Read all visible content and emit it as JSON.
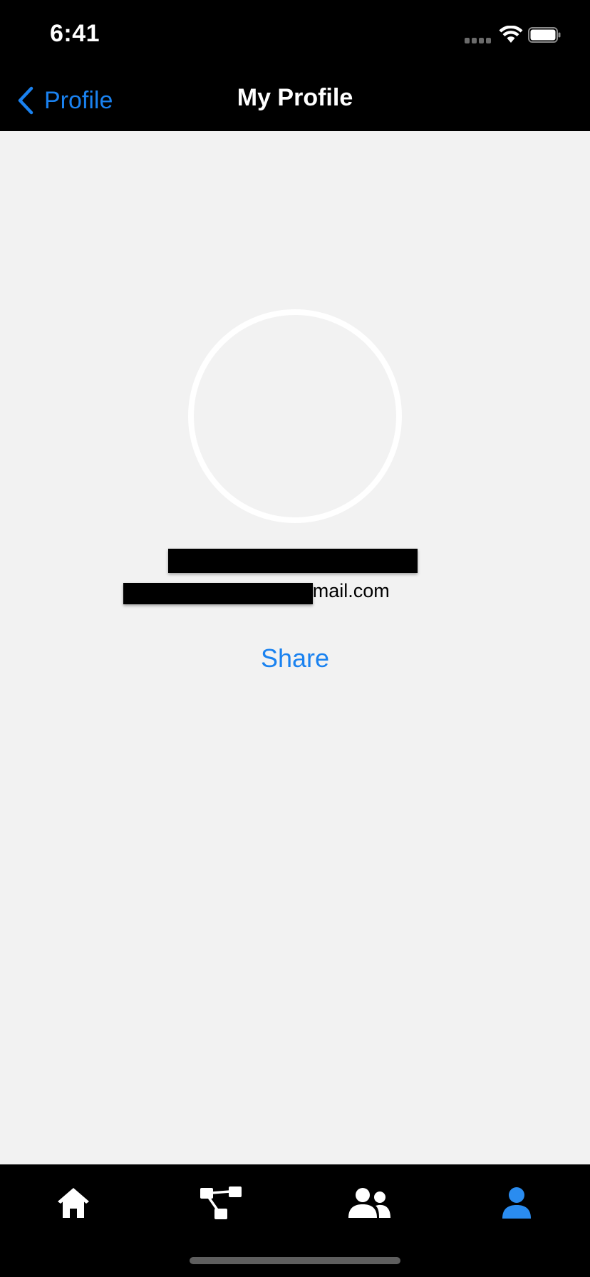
{
  "status_bar": {
    "time": "6:41"
  },
  "nav_bar": {
    "back_label": "Profile",
    "title": "My Profile",
    "accent_color": "#1a82f0"
  },
  "profile": {
    "name": "",
    "email_visible_suffix": "3@gmail.com",
    "share_label": "Share"
  },
  "tab_bar": {
    "tabs": [
      {
        "icon": "home-icon",
        "selected": false
      },
      {
        "icon": "network-icon",
        "selected": false
      },
      {
        "icon": "people-icon",
        "selected": false
      },
      {
        "icon": "person-icon",
        "selected": true
      }
    ],
    "selected_color": "#2a8cf0",
    "unselected_color": "#ffffff"
  }
}
